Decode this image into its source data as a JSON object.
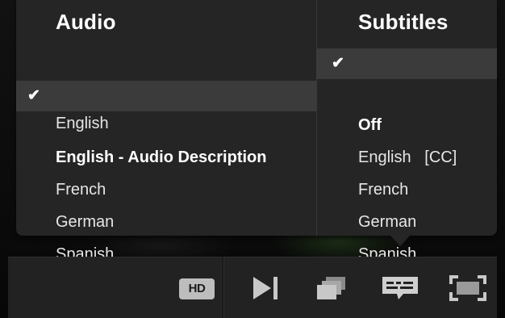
{
  "audio": {
    "title": "Audio",
    "options": [
      {
        "label": "English",
        "selected": false
      },
      {
        "label": "English - Audio Description",
        "selected": true
      },
      {
        "label": "French",
        "selected": false
      },
      {
        "label": "German",
        "selected": false
      },
      {
        "label": "Spanish",
        "selected": false
      }
    ]
  },
  "subtitles": {
    "title": "Subtitles",
    "options": [
      {
        "label": "Off",
        "selected": true
      },
      {
        "label": "English   [CC]",
        "selected": false
      },
      {
        "label": "French",
        "selected": false
      },
      {
        "label": "German",
        "selected": false
      },
      {
        "label": "Spanish",
        "selected": false
      }
    ]
  },
  "check_mark": "✔",
  "controls": {
    "hd_label": "HD",
    "icons": [
      "hd-icon",
      "next-episode-icon",
      "episodes-icon",
      "subtitles-icon",
      "fullscreen-icon"
    ]
  },
  "colors": {
    "panel": "#252525",
    "selected_row": "#3b3b3b",
    "text": "#e6e6e6",
    "icon": "#c8c8c8"
  }
}
